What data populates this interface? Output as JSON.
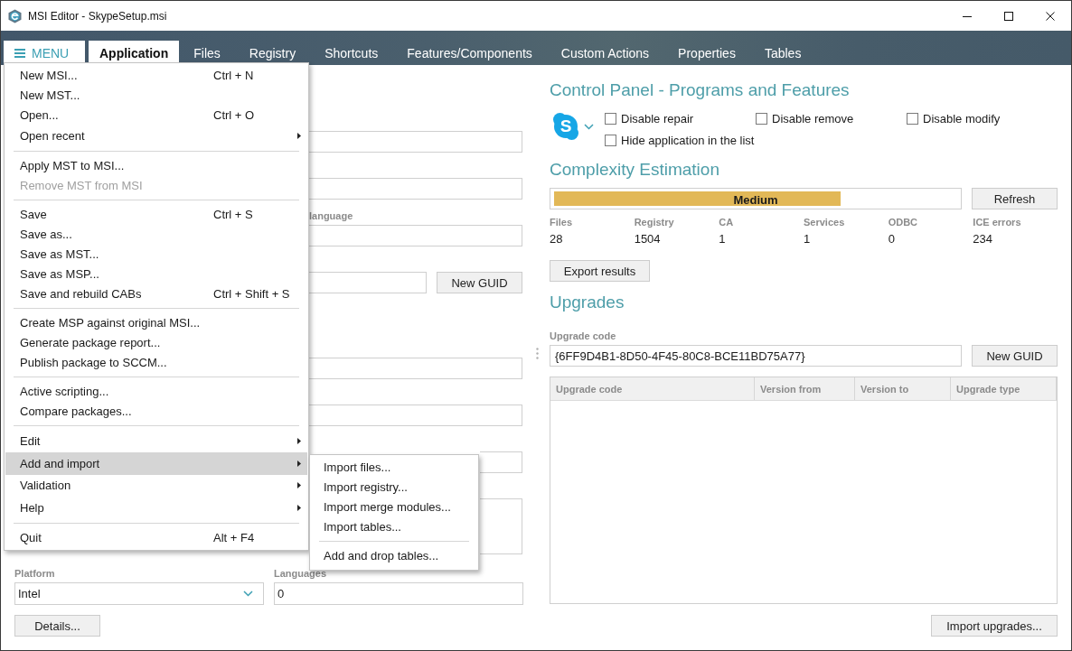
{
  "window": {
    "title": "MSI Editor - SkypeSetup.msi"
  },
  "menu_button": {
    "label": "MENU"
  },
  "tabs": [
    {
      "label": "Application",
      "selected": true
    },
    {
      "label": "Files",
      "selected": false
    },
    {
      "label": "Registry",
      "selected": false
    },
    {
      "label": "Shortcuts",
      "selected": false
    },
    {
      "label": "Features/Components",
      "selected": false
    },
    {
      "label": "Custom Actions",
      "selected": false
    },
    {
      "label": "Properties",
      "selected": false
    },
    {
      "label": "Tables",
      "selected": false
    }
  ],
  "application_form": {
    "sections": [
      {
        "fields": [
          {
            "kind": "text"
          },
          {
            "kind": "text"
          },
          {
            "kind": "text",
            "label": "language"
          },
          {
            "kind": "guid",
            "button": "New GUID"
          }
        ]
      },
      {
        "fields": [
          {
            "kind": "text"
          },
          {
            "kind": "text"
          },
          {
            "kind": "text"
          },
          {
            "kind": "multiline"
          }
        ]
      }
    ],
    "platform": {
      "label": "Platform",
      "value": "Intel"
    },
    "languages": {
      "label": "Languages",
      "value": "0"
    },
    "details_button": "Details..."
  },
  "programs_and_features": {
    "title": "Control Panel - Programs and Features",
    "icon_letter": "S",
    "options": [
      {
        "label": "Disable repair",
        "checked": false
      },
      {
        "label": "Disable remove",
        "checked": false
      },
      {
        "label": "Disable modify",
        "checked": false
      },
      {
        "label": "Hide application in the list",
        "checked": false
      }
    ]
  },
  "complexity_estimation": {
    "title": "Complexity Estimation",
    "level": 0.71,
    "rating": "Medium",
    "refresh_button": "Refresh",
    "stats": [
      {
        "label": "Files",
        "value": "28"
      },
      {
        "label": "Registry",
        "value": "1504"
      },
      {
        "label": "CA",
        "value": "1"
      },
      {
        "label": "Services",
        "value": "1"
      },
      {
        "label": "ODBC",
        "value": "0"
      },
      {
        "label": "ICE errors",
        "value": "234"
      }
    ],
    "export_button": "Export results"
  },
  "upgrades": {
    "title": "Upgrades",
    "upgrade_code": {
      "label": "Upgrade code",
      "value": "{6FF9D4B1-8D50-4F45-80C8-BCE11BD75A77}"
    },
    "new_guid_button": "New GUID",
    "table": {
      "columns": [
        "Upgrade code",
        "Version from",
        "Version to",
        "Upgrade type"
      ]
    },
    "import_button": "Import upgrades..."
  },
  "main_menu": {
    "items": [
      {
        "kind": "command",
        "label": "New MSI...",
        "shortcut": "Ctrl + N",
        "selected": false,
        "disabled": false
      },
      {
        "kind": "command",
        "label": "New MST...",
        "selected": false,
        "disabled": false
      },
      {
        "kind": "command",
        "label": "Open...",
        "shortcut": "Ctrl + O",
        "selected": false,
        "disabled": false
      },
      {
        "kind": "submenu",
        "label": "Open recent",
        "selected": false,
        "disabled": false
      },
      {
        "kind": "separator"
      },
      {
        "kind": "command",
        "label": "Apply MST to MSI...",
        "selected": false,
        "disabled": false
      },
      {
        "kind": "command",
        "label": "Remove MST from MSI",
        "selected": false,
        "disabled": true
      },
      {
        "kind": "separator"
      },
      {
        "kind": "command",
        "label": "Save",
        "shortcut": "Ctrl + S",
        "selected": false,
        "disabled": false
      },
      {
        "kind": "command",
        "label": "Save as...",
        "selected": false,
        "disabled": false
      },
      {
        "kind": "command",
        "label": "Save as MST...",
        "selected": false,
        "disabled": false
      },
      {
        "kind": "command",
        "label": "Save as MSP...",
        "selected": false,
        "disabled": false
      },
      {
        "kind": "command",
        "label": "Save and rebuild CABs",
        "shortcut": "Ctrl + Shift + S",
        "selected": false,
        "disabled": false
      },
      {
        "kind": "separator"
      },
      {
        "kind": "command",
        "label": "Create MSP against original MSI...",
        "selected": false,
        "disabled": false
      },
      {
        "kind": "command",
        "label": "Generate package report...",
        "selected": false,
        "disabled": false
      },
      {
        "kind": "command",
        "label": "Publish package to SCCM...",
        "selected": false,
        "disabled": false
      },
      {
        "kind": "separator"
      },
      {
        "kind": "command",
        "label": "Active scripting...",
        "selected": false,
        "disabled": false
      },
      {
        "kind": "command",
        "label": "Compare packages...",
        "selected": false,
        "disabled": false
      },
      {
        "kind": "separator"
      },
      {
        "kind": "submenu",
        "label": "Edit",
        "selected": false,
        "disabled": false
      },
      {
        "kind": "submenu",
        "label": "Add and import",
        "selected": true,
        "disabled": false
      },
      {
        "kind": "submenu",
        "label": "Validation",
        "selected": false,
        "disabled": false
      },
      {
        "kind": "submenu",
        "label": "Help",
        "selected": false,
        "disabled": false
      },
      {
        "kind": "separator"
      },
      {
        "kind": "command",
        "label": "Quit",
        "shortcut": "Alt + F4",
        "selected": false,
        "disabled": false
      }
    ]
  },
  "submenu": {
    "items": [
      {
        "kind": "command",
        "label": "Import files...",
        "selected": false,
        "disabled": false
      },
      {
        "kind": "command",
        "label": "Import registry...",
        "selected": false,
        "disabled": false
      },
      {
        "kind": "command",
        "label": "Import merge modules...",
        "selected": false,
        "disabled": false
      },
      {
        "kind": "command",
        "label": "Import tables...",
        "selected": false,
        "disabled": false
      },
      {
        "kind": "separator"
      },
      {
        "kind": "command",
        "label": "Add and drop tables...",
        "selected": false,
        "disabled": false
      }
    ]
  }
}
